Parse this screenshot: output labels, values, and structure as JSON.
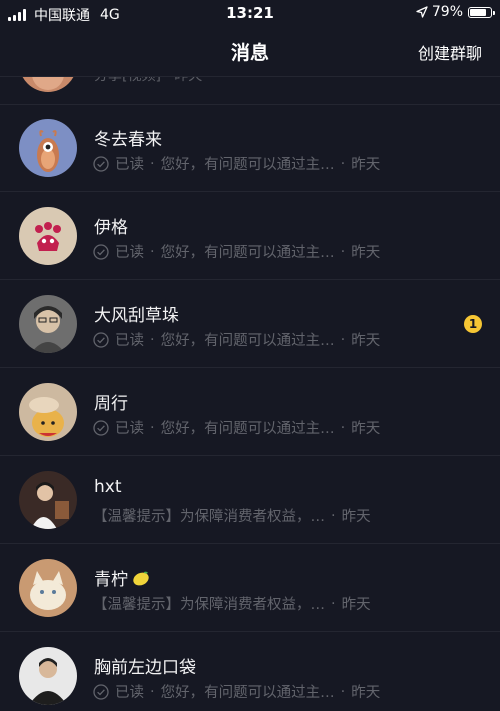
{
  "status_bar": {
    "carrier": "中国联通",
    "network": "4G",
    "time": "13:21",
    "battery_text": "79%",
    "battery_level": 0.79,
    "icons": [
      "signal-icon",
      "location-arrow-icon",
      "battery-icon"
    ]
  },
  "header": {
    "title": "消息",
    "action_label": "创建群聊"
  },
  "partial_row": {
    "preview": "分享[视频] · 昨天"
  },
  "conversations": [
    {
      "name": "冬去春来",
      "read_label": "已读",
      "separator": "·",
      "message": "您好，有问题可以通过主…",
      "time": "昨天",
      "badge": ""
    },
    {
      "name": "伊格",
      "read_label": "已读",
      "separator": "·",
      "message": "您好，有问题可以通过主…",
      "time": "昨天",
      "badge": ""
    },
    {
      "name": "大风刮草垛",
      "read_label": "已读",
      "separator": "·",
      "message": "您好，有问题可以通过主…",
      "time": "昨天",
      "badge": "1"
    },
    {
      "name": "周行",
      "read_label": "已读",
      "separator": "·",
      "message": "您好，有问题可以通过主…",
      "time": "昨天",
      "badge": ""
    },
    {
      "name": "hxt",
      "read_label": "",
      "separator": "",
      "message": "【温馨提示】为保障消费者权益，…",
      "time": "昨天",
      "badge": ""
    },
    {
      "name": "青柠",
      "read_label": "",
      "separator": "",
      "message": "【温馨提示】为保障消费者权益，…",
      "time": "昨天",
      "badge": ""
    },
    {
      "name": "胸前左边口袋",
      "read_label": "已读",
      "separator": "·",
      "message": "您好，有问题可以通过主…",
      "time": "昨天",
      "badge": ""
    }
  ],
  "colors": {
    "background": "#161823",
    "divider": "#242631",
    "secondary_text": "#62646c",
    "badge": "#f6c634"
  }
}
